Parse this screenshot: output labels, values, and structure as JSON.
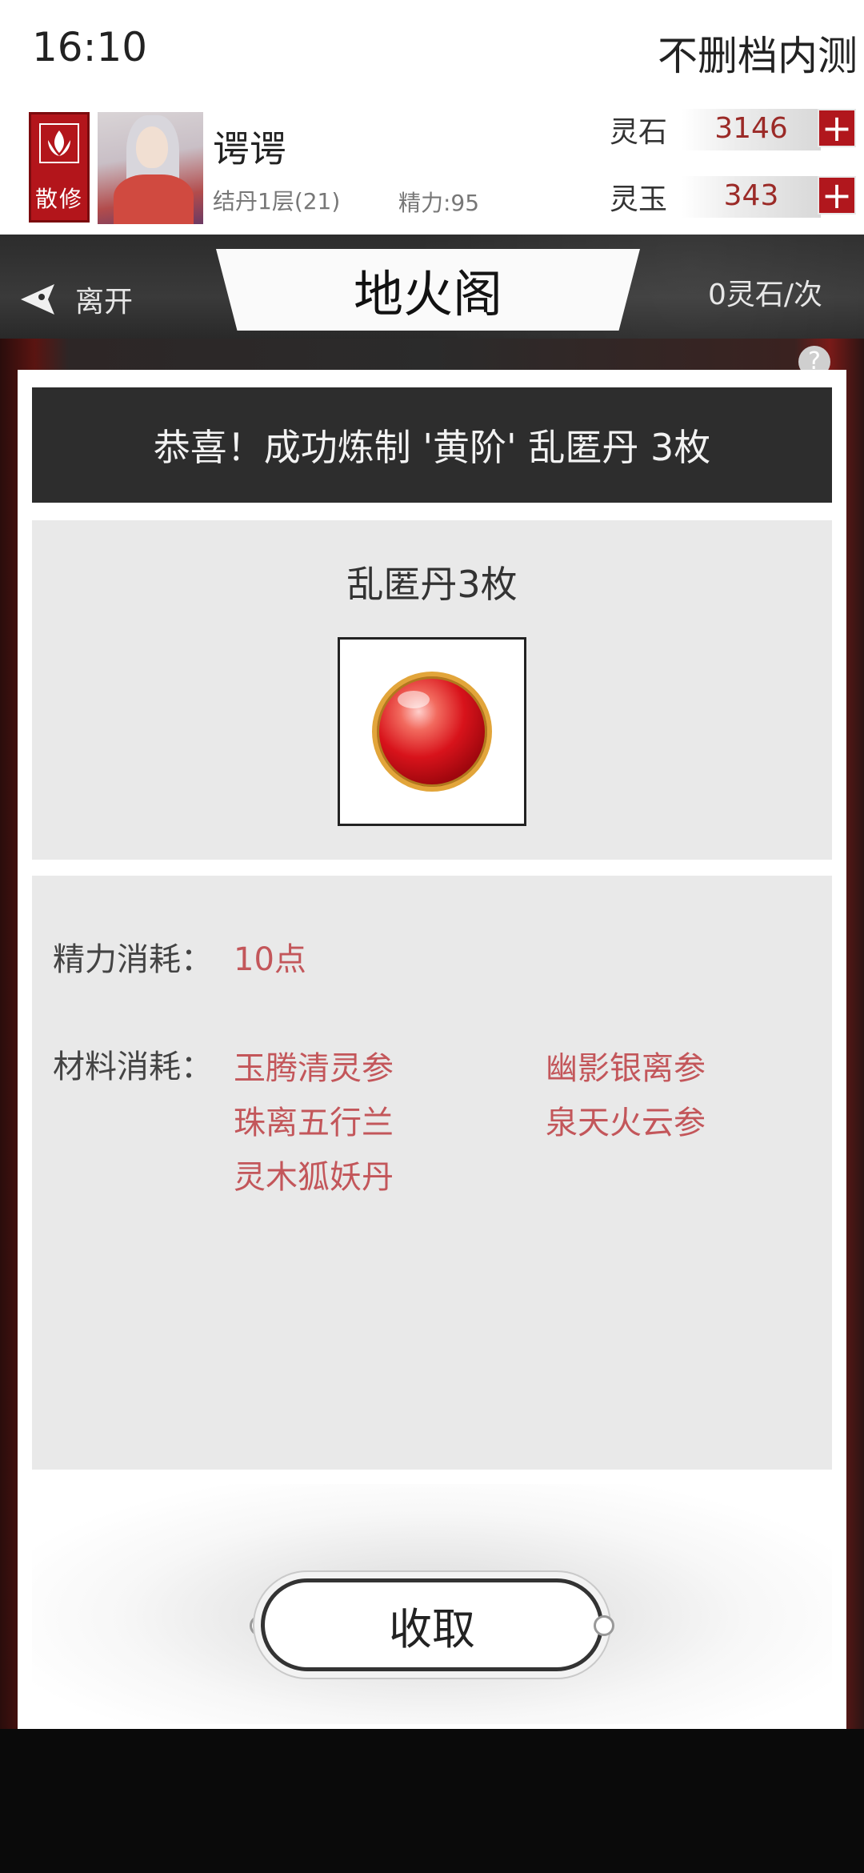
{
  "status_bar": {
    "time": "16:10",
    "server": "不删档内测"
  },
  "player": {
    "sect_label": "散修",
    "name": "谔谔",
    "realm": "结丹1层(21)",
    "energy": "精力:95",
    "currencies": [
      {
        "label": "灵石",
        "value": "3146",
        "plus": "+"
      },
      {
        "label": "灵玉",
        "value": "343",
        "plus": "+"
      }
    ]
  },
  "titlebar": {
    "leave_label": "离开",
    "title": "地火阁",
    "cost": "0灵石/次",
    "help": "?"
  },
  "result": {
    "banner": "恭喜！成功炼制 '黄阶' 乱匿丹 3枚",
    "product_name": "乱匿丹3枚",
    "product_icon": "red-pill-icon",
    "energy_cost_label": "精力消耗：",
    "energy_cost_value": "10点",
    "materials_label": "材料消耗：",
    "materials": [
      "玉腾清灵参",
      "幽影银离参",
      "珠离五行兰",
      "泉天火云参",
      "灵木狐妖丹"
    ]
  },
  "actions": {
    "collect_label": "收取"
  },
  "colors": {
    "accent_red": "#b1171d",
    "cost_text": "#c3565a",
    "banner_bg": "#2d2d2d"
  }
}
